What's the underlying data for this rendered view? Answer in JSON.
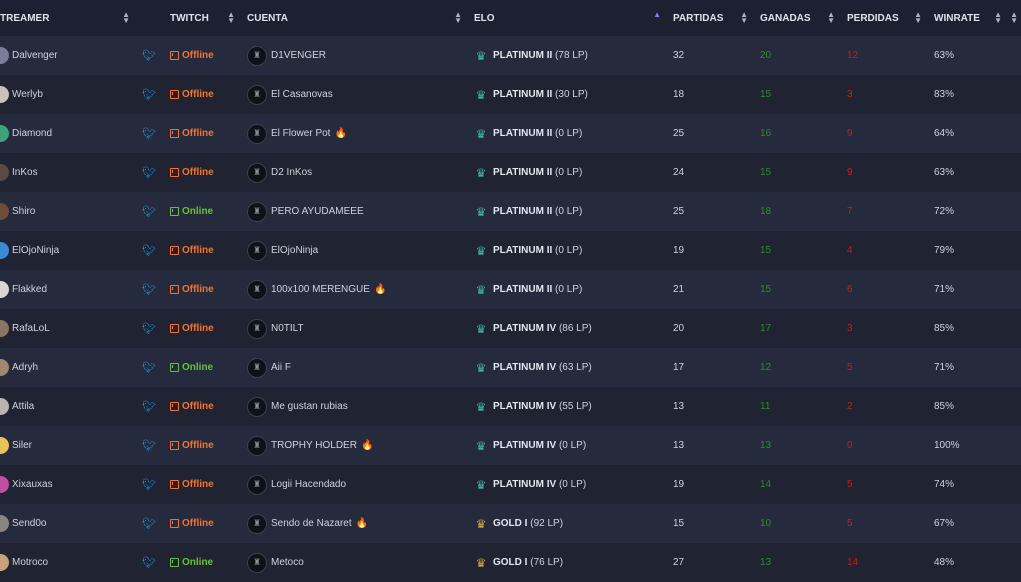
{
  "headers": {
    "streamer": "TREAMER",
    "twitch": "TWITCH",
    "cuenta": "CUENTA",
    "elo": "ELO",
    "partidas": "PARTIDAS",
    "ganadas": "GANADAS",
    "perdidas": "PERDIDAS",
    "winrate": "WINRATE"
  },
  "colors": {
    "offline": "#f2742d",
    "online": "#67c23a",
    "twitter": "#1da1f2",
    "wins": "#2f8a2f",
    "losses": "#c81e1e"
  },
  "rows": [
    {
      "streamer": "Dalvenger",
      "status": "Offline",
      "account": "D1VENGER",
      "fire": false,
      "tier": "PLATINUM II",
      "lp": "(78 LP)",
      "partidas": "32",
      "ganadas": "20",
      "perdidas": "12",
      "winrate": "63%",
      "avatar": "#7a7e9a"
    },
    {
      "streamer": "Werlyb",
      "status": "Offline",
      "account": "El Casanovas",
      "fire": false,
      "tier": "PLATINUM II",
      "lp": "(30 LP)",
      "partidas": "18",
      "ganadas": "15",
      "perdidas": "3",
      "winrate": "83%",
      "avatar": "#c9c3bb"
    },
    {
      "streamer": "Diamond",
      "status": "Offline",
      "account": "El Flower Pot",
      "fire": true,
      "tier": "PLATINUM II",
      "lp": "(0 LP)",
      "partidas": "25",
      "ganadas": "16",
      "perdidas": "9",
      "winrate": "64%",
      "avatar": "#3ba27a"
    },
    {
      "streamer": "InKos",
      "status": "Offline",
      "account": "D2 InKos",
      "fire": false,
      "tier": "PLATINUM II",
      "lp": "(0 LP)",
      "partidas": "24",
      "ganadas": "15",
      "perdidas": "9",
      "winrate": "63%",
      "avatar": "#5a4a44"
    },
    {
      "streamer": "Shiro",
      "status": "Online",
      "account": "PERO AYUDAMEEE",
      "fire": false,
      "tier": "PLATINUM II",
      "lp": "(0 LP)",
      "partidas": "25",
      "ganadas": "18",
      "perdidas": "7",
      "winrate": "72%",
      "avatar": "#6e4b3a"
    },
    {
      "streamer": "ElOjoNinja",
      "status": "Offline",
      "account": "ElOjoNinja",
      "fire": false,
      "tier": "PLATINUM II",
      "lp": "(0 LP)",
      "partidas": "19",
      "ganadas": "15",
      "perdidas": "4",
      "winrate": "79%",
      "avatar": "#3b8ad8"
    },
    {
      "streamer": "Flakked",
      "status": "Offline",
      "account": "100x100 MERENGUE",
      "fire": true,
      "tier": "PLATINUM II",
      "lp": "(0 LP)",
      "partidas": "21",
      "ganadas": "15",
      "perdidas": "6",
      "winrate": "71%",
      "avatar": "#d9d6d2"
    },
    {
      "streamer": "RafaLoL",
      "status": "Offline",
      "account": "N0TILT",
      "fire": false,
      "tier": "PLATINUM IV",
      "lp": "(86 LP)",
      "partidas": "20",
      "ganadas": "17",
      "perdidas": "3",
      "winrate": "85%",
      "avatar": "#8a7464"
    },
    {
      "streamer": "Adryh",
      "status": "Online",
      "account": "Aii F",
      "fire": false,
      "tier": "PLATINUM IV",
      "lp": "(63 LP)",
      "partidas": "17",
      "ganadas": "12",
      "perdidas": "5",
      "winrate": "71%",
      "avatar": "#a08870"
    },
    {
      "streamer": "Attila",
      "status": "Offline",
      "account": "Me gustan rubias",
      "fire": false,
      "tier": "PLATINUM IV",
      "lp": "(55 LP)",
      "partidas": "13",
      "ganadas": "11",
      "perdidas": "2",
      "winrate": "85%",
      "avatar": "#b9b4ae"
    },
    {
      "streamer": "Siler",
      "status": "Offline",
      "account": "TROPHY HOLDER",
      "fire": true,
      "tier": "PLATINUM IV",
      "lp": "(0 LP)",
      "partidas": "13",
      "ganadas": "13",
      "perdidas": "0",
      "winrate": "100%",
      "avatar": "#e8c25a"
    },
    {
      "streamer": "Xixauxas",
      "status": "Offline",
      "account": "Logii Hacendado",
      "fire": false,
      "tier": "PLATINUM IV",
      "lp": "(0 LP)",
      "partidas": "19",
      "ganadas": "14",
      "perdidas": "5",
      "winrate": "74%",
      "avatar": "#c14ea0"
    },
    {
      "streamer": "Send0o",
      "status": "Offline",
      "account": "Sendo de Nazaret",
      "fire": true,
      "tier": "GOLD I",
      "lp": "(92 LP)",
      "partidas": "15",
      "ganadas": "10",
      "perdidas": "5",
      "winrate": "67%",
      "avatar": "#8b8580"
    },
    {
      "streamer": "Motroco",
      "status": "Online",
      "account": "Metoco",
      "fire": false,
      "tier": "GOLD I",
      "lp": "(76 LP)",
      "partidas": "27",
      "ganadas": "13",
      "perdidas": "14",
      "winrate": "48%",
      "avatar": "#c7a27a"
    }
  ]
}
